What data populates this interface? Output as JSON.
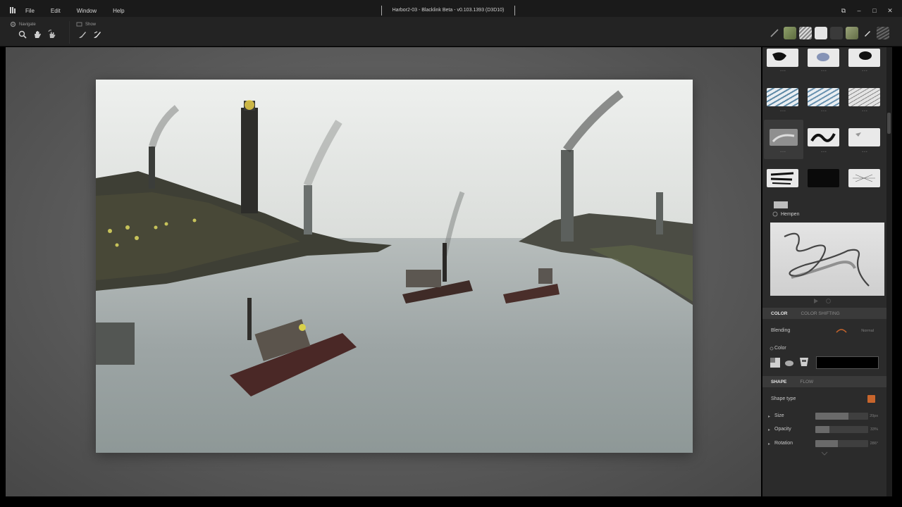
{
  "menu": [
    "File",
    "Edit",
    "Window",
    "Help"
  ],
  "window_title": "Harbor2-03 - Blacklink Beta - v0.103.1393 (D3D10)",
  "window_controls": [
    "restore-icon",
    "minimize-icon",
    "maximize-icon",
    "close-icon"
  ],
  "toolbar": {
    "navigate_label": "Navigate",
    "show_label": "Show"
  },
  "brush_panel": {
    "active_brush": "Hempen"
  },
  "color_section": {
    "tabs": [
      "COLOR",
      "COLOR SHIFTING"
    ],
    "blending_label": "Blending",
    "blending_value": "Normal",
    "color_label": "Color",
    "current_color": "#000000"
  },
  "shape_section": {
    "tabs": [
      "SHAPE",
      "FLOW"
    ],
    "shape_type_label": "Shape type",
    "shape_swatch_color": "#c8652c",
    "properties": [
      {
        "label": "Size",
        "value": "20px",
        "level": 0.63
      },
      {
        "label": "Opacity",
        "value": "33%",
        "level": 0.27
      },
      {
        "label": "Rotation",
        "value": "286°",
        "level": 0.42
      }
    ]
  },
  "colors": {
    "accent": "#c8652c",
    "panel_bg": "#2b2b2b",
    "titlebar_bg": "#1a1a1a"
  }
}
